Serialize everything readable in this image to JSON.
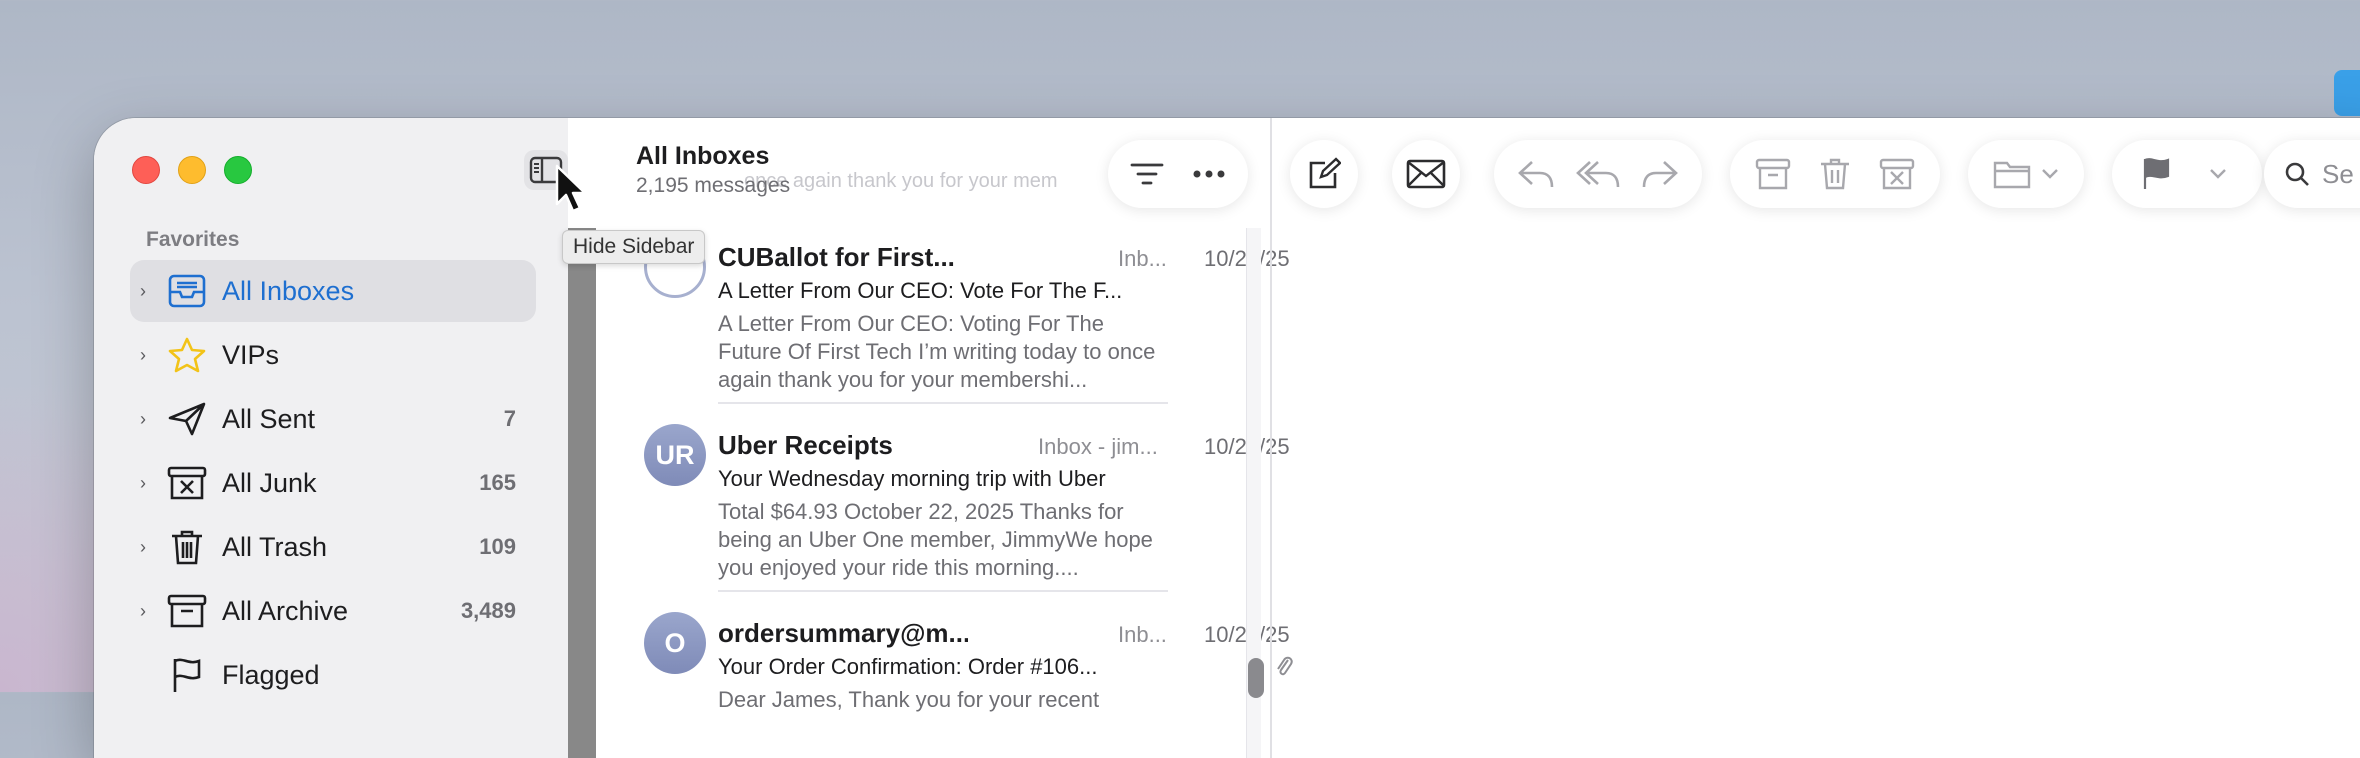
{
  "window": {
    "tooltip": "Hide Sidebar"
  },
  "sidebar": {
    "section_header": "Favorites",
    "items": [
      {
        "label": "All Inboxes",
        "count": "",
        "icon": "tray-icon",
        "selected": true
      },
      {
        "label": "VIPs",
        "count": "",
        "icon": "star-icon"
      },
      {
        "label": "All Sent",
        "count": "7",
        "icon": "paperplane-icon"
      },
      {
        "label": "All Junk",
        "count": "165",
        "icon": "junk-icon"
      },
      {
        "label": "All Trash",
        "count": "109",
        "icon": "trash-icon"
      },
      {
        "label": "All Archive",
        "count": "3,489",
        "icon": "archive-icon"
      },
      {
        "label": "Flagged",
        "count": "",
        "icon": "flag-icon"
      }
    ]
  },
  "list": {
    "title": "All Inboxes",
    "subtitle": "2,195 messages",
    "ghost_text_1": "once again thank you for your mem",
    "messages": [
      {
        "avatar": "",
        "sender": "CUBallot for First...",
        "mailbox": "Inb...",
        "date": "10/22/25",
        "subject": "A Letter From Our CEO: Vote For The F...",
        "preview": "A Letter From Our CEO: Voting For The Future Of First Tech I’m writing today to once again thank you for your membershi..."
      },
      {
        "avatar": "UR",
        "sender": "Uber Receipts",
        "mailbox": "Inbox - jim...",
        "date": "10/22/25",
        "subject": "Your Wednesday morning trip with Uber",
        "preview": "Total $64.93 October 22, 2025 Thanks for being an Uber One member, JimmyWe hope you enjoyed your ride this morning...."
      },
      {
        "avatar": "O",
        "sender": "ordersummary@m...",
        "mailbox": "Inb...",
        "date": "10/22/25",
        "subject": "Your Order Confirmation: Order #106...",
        "preview": "Dear James, Thank you for your recent"
      }
    ]
  },
  "reader": {
    "search_placeholder": "Se"
  },
  "colors": {
    "accent": "#1e6fd0",
    "close": "#fe5f57",
    "minimize": "#febc2e",
    "zoom": "#28c840",
    "vip_star": "#f2c318"
  }
}
